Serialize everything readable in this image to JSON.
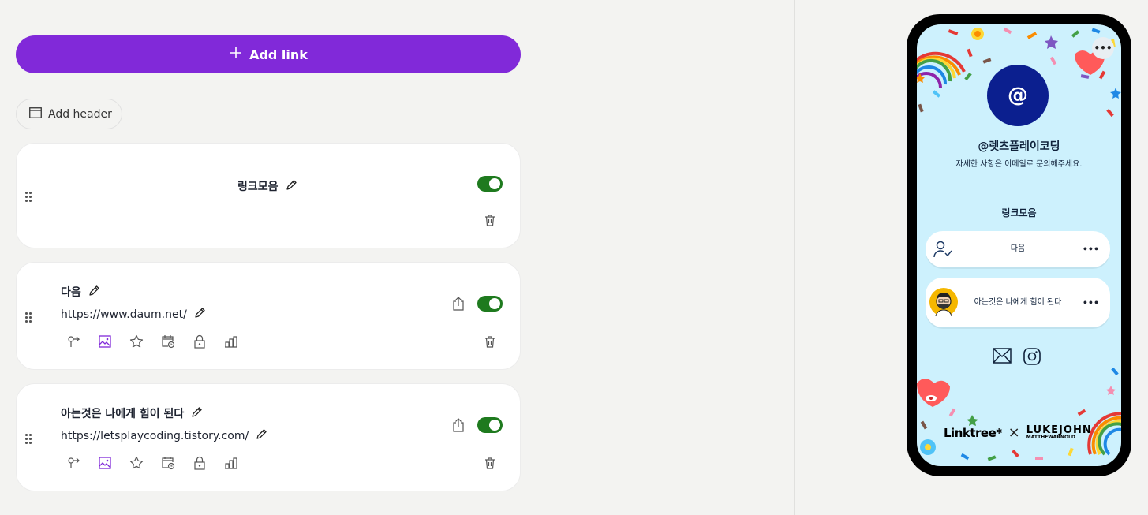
{
  "toolbar": {
    "add_link_label": "Add link",
    "add_header_label": "Add header"
  },
  "header_card": {
    "title": "링크모음",
    "enabled": true
  },
  "links": [
    {
      "title": "다음",
      "url": "https://www.daum.net/",
      "enabled": true
    },
    {
      "title": "아는것은 나에게 힘이 된다",
      "url": "https://letsplaycoding.tistory.com/",
      "enabled": true
    }
  ],
  "link_tools": [
    "redirect-icon",
    "thumbnail-icon",
    "star-icon",
    "schedule-icon",
    "lock-icon",
    "analytics-icon"
  ],
  "preview": {
    "avatar_text": "@",
    "profile_name": "@렛츠플레이코딩",
    "bio": "자세한 사항은 이메일로 문의해주세요.",
    "header": "링크모음",
    "links": [
      "다음",
      "아는것은 나에게 힘이 된다"
    ],
    "more_symbol": "•••",
    "footer_brand": "Linktree*",
    "footer_x": "×",
    "collab_name": "LUKEJOHN",
    "collab_sub": "MATTHEWARNOLD"
  },
  "colors": {
    "accent": "#8129d9",
    "toggle_on": "#1e7a1e",
    "preview_bg": "#cdf1fd",
    "avatar_bg": "#0b1f8f"
  }
}
